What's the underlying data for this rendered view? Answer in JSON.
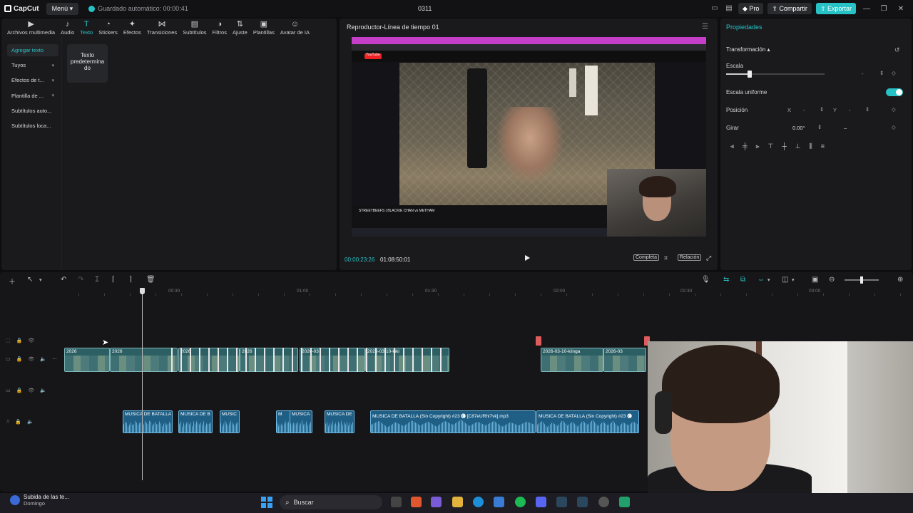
{
  "titlebar": {
    "app_name": "CapCut",
    "menu_label": "Menú",
    "autosave_text": "Guardado automático: 00:00:41",
    "project_title": "0311",
    "pro_label": "Pro",
    "share_label": "Compartir",
    "export_label": "Exportar"
  },
  "toolbar": {
    "items": [
      {
        "label": "Archivos multimedia",
        "icon": "media-icon"
      },
      {
        "label": "Audio",
        "icon": "audio-icon"
      },
      {
        "label": "Texto",
        "icon": "text-icon"
      },
      {
        "label": "Stickers",
        "icon": "sticker-icon"
      },
      {
        "label": "Efectos",
        "icon": "effects-icon"
      },
      {
        "label": "Transiciones",
        "icon": "transitions-icon"
      },
      {
        "label": "Subtítulos",
        "icon": "subtitles-icon"
      },
      {
        "label": "Filtros",
        "icon": "filters-icon"
      },
      {
        "label": "Ajuste",
        "icon": "adjust-icon"
      },
      {
        "label": "Plantillas",
        "icon": "templates-icon"
      },
      {
        "label": "Avatar de IA",
        "icon": "ai-avatar-icon"
      }
    ],
    "active_index": 2
  },
  "sidebar": {
    "items": [
      {
        "label": "Agregar texto"
      },
      {
        "label": "Tuyos"
      },
      {
        "label": "Efectos de t..."
      },
      {
        "label": "Plantilla de ..."
      },
      {
        "label": "Subtítulos auto..."
      },
      {
        "label": "Subtítulos loca..."
      }
    ]
  },
  "text_panel": {
    "default_card": "Texto predetermina do"
  },
  "player": {
    "title": "Reproductor-Línea de tiempo 01",
    "current_time": "00:00:23:26",
    "total_time": "01:08:50:01",
    "full_label": "Completa",
    "ratio_label": "Relación",
    "video_caption": "STREETBEEFS | BLACKIE CHAN vs METHAM",
    "yt_label": "YouTube"
  },
  "properties": {
    "header": "Propiedades",
    "section": "Transformación",
    "scale_label": "Escala",
    "scale_value": "-",
    "scale_fraction": 0.24,
    "uniform_label": "Escala uniforme",
    "uniform_on": true,
    "position_label": "Posición",
    "pos_x_label": "X",
    "pos_x_value": "-",
    "pos_y_label": "Y",
    "pos_y_value": "-",
    "rotate_label": "Girar",
    "rotate_value": "0.00°",
    "rotate_extra": "–"
  },
  "timeline": {
    "ruler": [
      "00:30",
      "01:00",
      "01:30",
      "02:00",
      "02:30",
      "03:00"
    ],
    "video_clips": [
      {
        "label": "2026"
      },
      {
        "label": "2026"
      },
      {
        "label": "2026"
      },
      {
        "label": "2026"
      },
      {
        "label": "2026-03"
      },
      {
        "label": "2026-03-10-kiki"
      },
      {
        "label": "2026-03-10-kiinga"
      },
      {
        "label": "2026-03"
      }
    ],
    "audio_clips": [
      {
        "label": "MUSICA DE BATALLA"
      },
      {
        "label": "MUSICA DE B"
      },
      {
        "label": "MUSIC"
      },
      {
        "label": "M"
      },
      {
        "label": "MUSICA"
      },
      {
        "label": "MUSICA DE"
      },
      {
        "label": "MUSICA DE BATALLA (Sin Copyright) #23 🅒 [C87eURhl7vk].mp3"
      },
      {
        "label": "MUSICA DE BATALLA (Sin Copyright) #23 🅒"
      }
    ]
  },
  "taskbar": {
    "notif_title": "Subida de las te...",
    "notif_sub": "Domingo",
    "search_label": "Buscar"
  },
  "colors": {
    "accent": "#27c2c5",
    "video_clip": "#2c5f63",
    "audio_clip": "#1f5f86",
    "marker": "#e05c5c"
  }
}
